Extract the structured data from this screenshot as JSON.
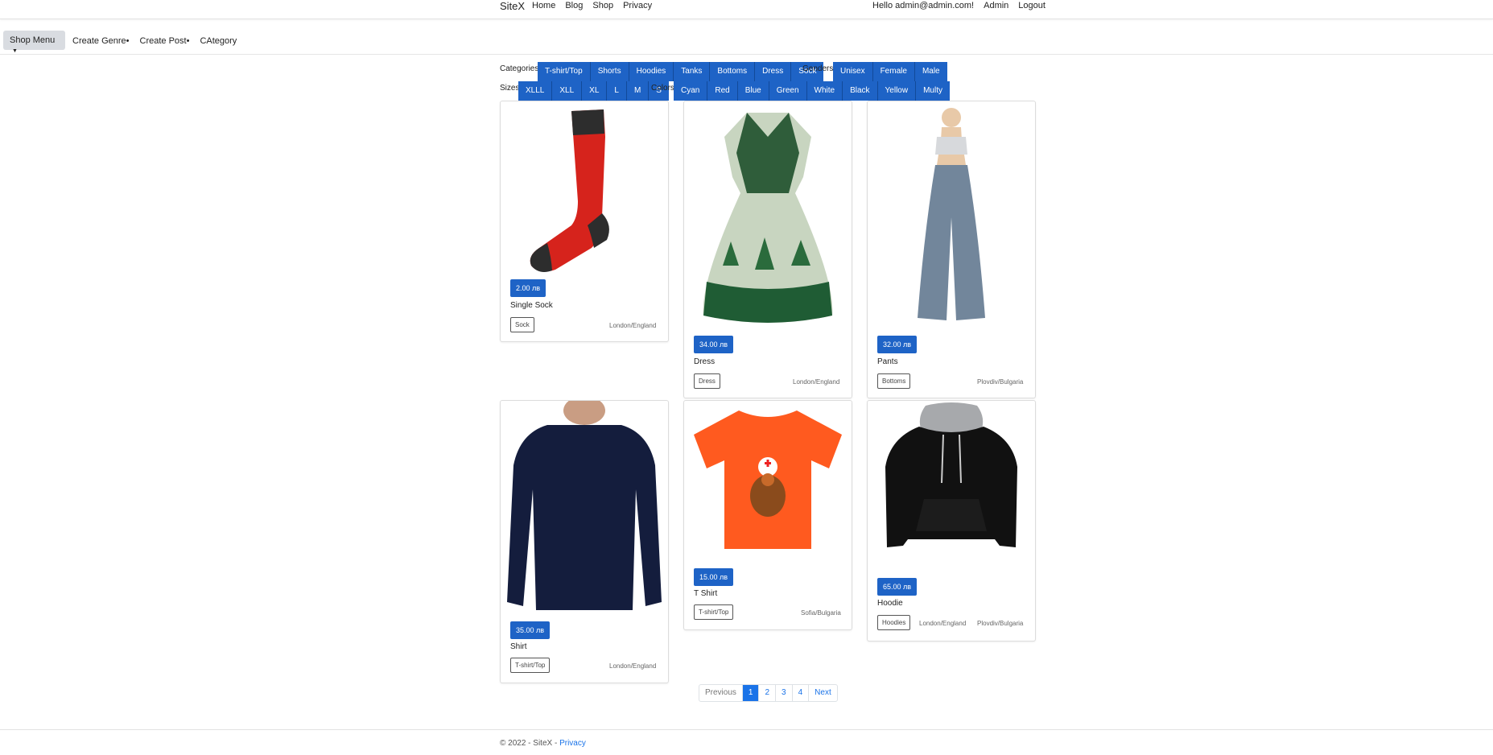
{
  "topnav": {
    "brand": "SiteX",
    "links": [
      "Home",
      "Blog",
      "Shop",
      "Privacy"
    ],
    "greeting": "Hello admin@admin.com!",
    "admin": "Admin",
    "logout": "Logout"
  },
  "subnav": {
    "shop_menu": "Shop Menu",
    "items": [
      "Create Genre•",
      "Create Post•",
      "CAtegory"
    ]
  },
  "filters": {
    "categories_label": "Categories",
    "categories": [
      "T-shirt/Top",
      "Shorts",
      "Hoodies",
      "Tanks",
      "Bottoms",
      "Dress",
      "Sock"
    ],
    "genders_label": "Genders",
    "genders": [
      "Unisex",
      "Female",
      "Male"
    ],
    "sizes_label": "Sizes",
    "sizes": [
      "XLLL",
      "XLL",
      "XL",
      "L",
      "M",
      "S"
    ],
    "colors_label": "Colors",
    "colors": [
      "Cyan",
      "Red",
      "Blue",
      "Green",
      "White",
      "Black",
      "Yellow",
      "Multy"
    ]
  },
  "products": [
    {
      "name": "Single Sock",
      "price": "2.00 лв",
      "tag": "Sock",
      "locations": [
        "London/England"
      ],
      "image": "red-sock"
    },
    {
      "name": "Dress",
      "price": "34.00 лв",
      "tag": "Dress",
      "locations": [
        "London/England"
      ],
      "image": "green-dress"
    },
    {
      "name": "Pants",
      "price": "32.00 лв",
      "tag": "Bottoms",
      "locations": [
        "Plovdiv/Bulgaria"
      ],
      "image": "grey-pants"
    },
    {
      "name": "Shirt",
      "price": "35.00 лв",
      "tag": "T-shirt/Top",
      "locations": [
        "London/England"
      ],
      "image": "navy-longsleeve"
    },
    {
      "name": "T Shirt",
      "price": "15.00 лв",
      "tag": "T-shirt/Top",
      "locations": [
        "Sofia/Bulgaria"
      ],
      "image": "orange-turkey-tshirt"
    },
    {
      "name": "Hoodie",
      "price": "65.00 лв",
      "tag": "Hoodies",
      "locations": [
        "London/England",
        "Plovdiv/Bulgaria"
      ],
      "image": "black-hoodie"
    }
  ],
  "pagination": {
    "previous": "Previous",
    "pages": [
      "1",
      "2",
      "3",
      "4"
    ],
    "current": "1",
    "next": "Next"
  },
  "footer": {
    "copyright": "© 2022 - SiteX -",
    "privacy": "Privacy"
  },
  "colors": {
    "primary": "#1e63c6",
    "link": "#1a73e8"
  }
}
